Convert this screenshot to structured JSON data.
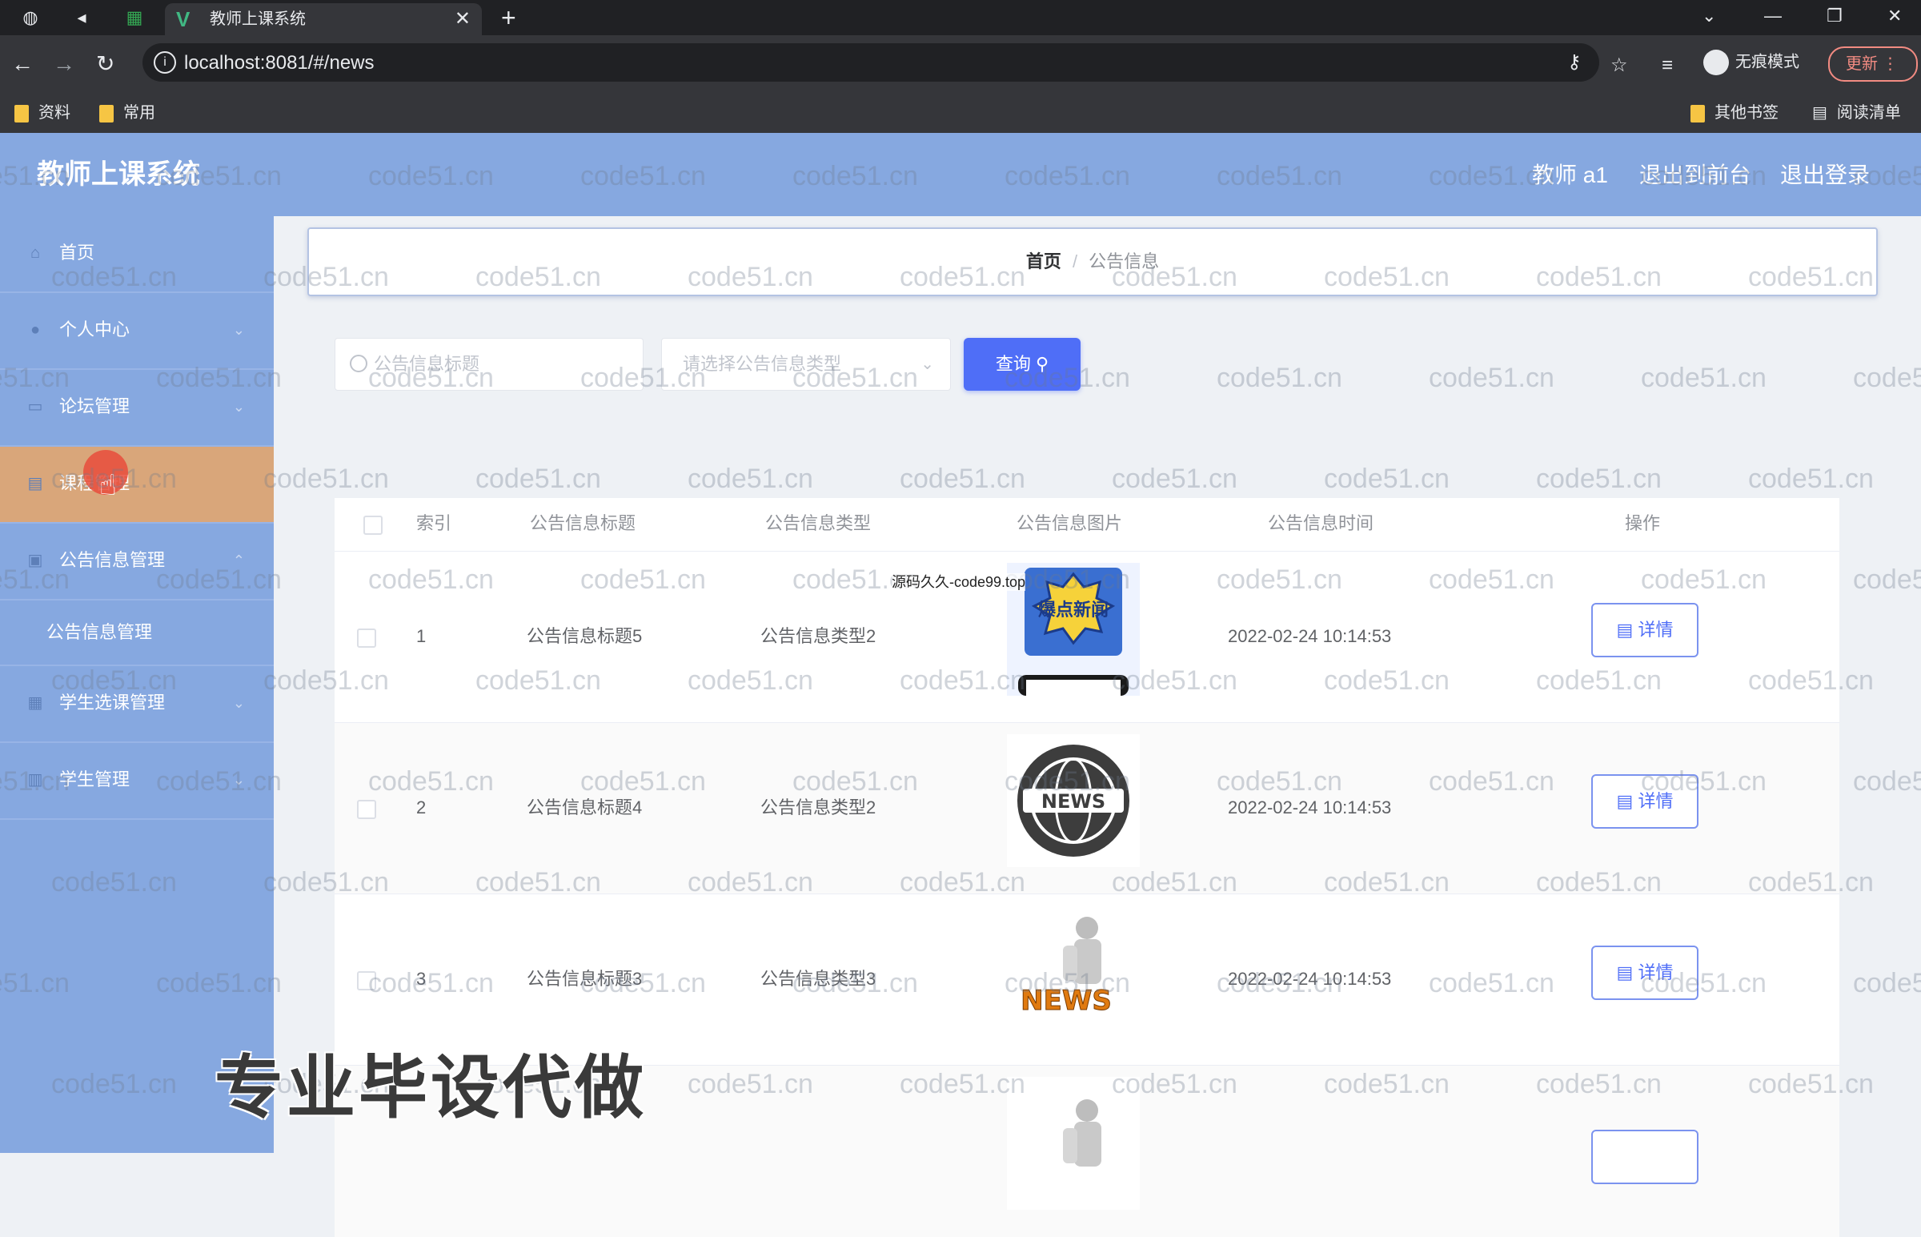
{
  "browser": {
    "tab_title": "教师上课系统",
    "url": "localhost:8081/#/news",
    "incognito_label": "无痕模式",
    "update_label": "更新",
    "bookmarks": [
      "资料",
      "常用"
    ],
    "other_bookmarks": "其他书签",
    "reading_list": "阅读清单"
  },
  "header": {
    "title": "教师上课系统",
    "user": "教师 a1",
    "to_front": "退出到前台",
    "logout": "退出登录"
  },
  "sidebar": {
    "items": [
      {
        "label": "首页"
      },
      {
        "label": "个人中心"
      },
      {
        "label": "论坛管理"
      },
      {
        "label": "课程管理"
      },
      {
        "label": "公告信息管理"
      },
      {
        "label": "学生选课管理"
      },
      {
        "label": "学生管理"
      }
    ],
    "subitem": "公告信息管理"
  },
  "breadcrumb": {
    "home": "首页",
    "separator": "/",
    "current": "公告信息"
  },
  "search": {
    "title_placeholder": "公告信息标题",
    "type_placeholder": "请选择公告信息类型",
    "query_label": "查询"
  },
  "table": {
    "headers": [
      "索引",
      "公告信息标题",
      "公告信息类型",
      "公告信息图片",
      "公告信息时间",
      "操作"
    ],
    "rows": [
      {
        "index": "1",
        "title": "公告信息标题5",
        "type": "公告信息类型2",
        "image": "爆点新闻",
        "time": "2022-02-24 10:14:53",
        "action": "详情"
      },
      {
        "index": "2",
        "title": "公告信息标题4",
        "type": "公告信息类型2",
        "image": "NEWS",
        "time": "2022-02-24 10:14:53",
        "action": "详情"
      },
      {
        "index": "3",
        "title": "公告信息标题3",
        "type": "公告信息类型3",
        "image": "NEWS",
        "time": "2022-02-24 10:14:53",
        "action": "详情"
      }
    ]
  },
  "overlay": {
    "center_note": "源码久久-code99.top",
    "caption": "专业毕设代做",
    "watermark": "code51.cn"
  },
  "colors": {
    "header_bg": "#86a8e0",
    "active_menu": "#d9a67a",
    "primary": "#4f6ef7"
  }
}
